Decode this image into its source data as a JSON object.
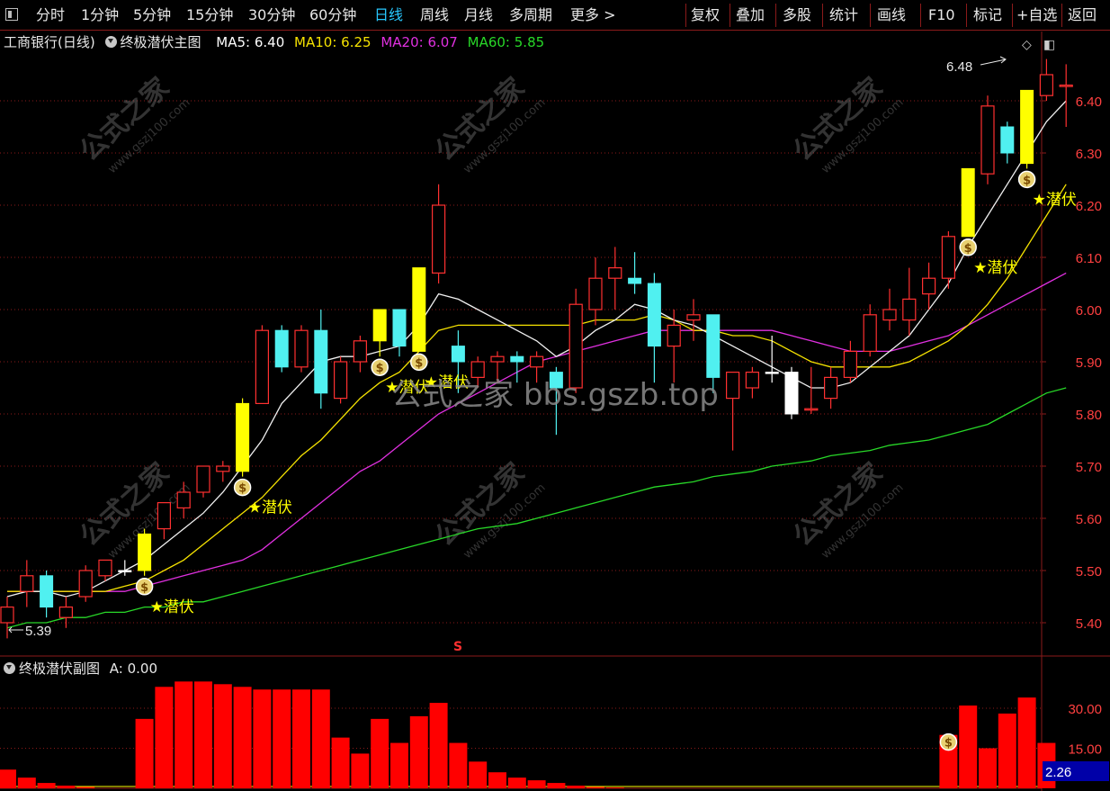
{
  "toolbar": {
    "left_items": [
      "分时",
      "1分钟",
      "5分钟",
      "15分钟",
      "30分钟",
      "60分钟",
      "日线",
      "周线",
      "月线",
      "多周期",
      "更多 >"
    ],
    "active_item": "日线",
    "right_items": [
      "复权",
      "叠加",
      "多股",
      "统计",
      "画线",
      "F10",
      "标记",
      "+自选",
      "返回"
    ]
  },
  "main_panel": {
    "title": "工商银行(日线)",
    "indicator_name": "终极潜伏主图",
    "ma": [
      {
        "label": "MA5: 6.40",
        "color": "#ffffff"
      },
      {
        "label": "MA10: 6.25",
        "color": "#f5e200"
      },
      {
        "label": "MA20: 6.07",
        "color": "#e030e0"
      },
      {
        "label": "MA60: 5.85",
        "color": "#28d828"
      }
    ],
    "high_label": "6.48",
    "low_label": "5.39",
    "signal_text": "潜伏",
    "signal_icon": "money-bag-icon",
    "event_mark": "S"
  },
  "sub_panel": {
    "indicator_name": "终极潜伏副图",
    "a_label": "A: 0.00",
    "current_value": "2.26",
    "y_ticks": [
      "30.00",
      "15.00"
    ]
  },
  "watermarks": {
    "text_cn": "公式之家",
    "text_url": "www.gszj100.com",
    "center_text": "公式之家 bbs.gszb.top"
  },
  "colors": {
    "up": "#ff3030",
    "down": "#50f0f0",
    "yellow_bar": "#ffff00",
    "grid": "#8b1a1a",
    "axis_text": "#ff4040",
    "bar": "#ff0000"
  },
  "chart_data": [
    {
      "type": "candlestick",
      "ylim": [
        5.35,
        6.5
      ],
      "y_ticks": [
        6.4,
        6.3,
        6.2,
        6.1,
        6.0,
        5.9,
        5.8,
        5.7,
        5.6,
        5.5,
        5.4
      ],
      "candles": [
        {
          "o": 5.4,
          "h": 5.45,
          "l": 5.37,
          "c": 5.43
        },
        {
          "o": 5.46,
          "h": 5.52,
          "l": 5.43,
          "c": 5.49
        },
        {
          "o": 5.49,
          "h": 5.5,
          "l": 5.41,
          "c": 5.43
        },
        {
          "o": 5.41,
          "h": 5.45,
          "l": 5.39,
          "c": 5.43
        },
        {
          "o": 5.45,
          "h": 5.51,
          "l": 5.44,
          "c": 5.5
        },
        {
          "o": 5.49,
          "h": 5.52,
          "l": 5.48,
          "c": 5.52
        },
        {
          "o": 5.5,
          "h": 5.52,
          "l": 5.49,
          "c": 5.5
        },
        {
          "o": 5.5,
          "h": 5.58,
          "l": 5.49,
          "c": 5.57
        },
        {
          "o": 5.58,
          "h": 5.63,
          "l": 5.56,
          "c": 5.63
        },
        {
          "o": 5.62,
          "h": 5.67,
          "l": 5.6,
          "c": 5.65
        },
        {
          "o": 5.65,
          "h": 5.7,
          "l": 5.64,
          "c": 5.7
        },
        {
          "o": 5.69,
          "h": 5.71,
          "l": 5.67,
          "c": 5.7
        },
        {
          "o": 5.69,
          "h": 5.83,
          "l": 5.68,
          "c": 5.82
        },
        {
          "o": 5.82,
          "h": 5.97,
          "l": 5.82,
          "c": 5.96
        },
        {
          "o": 5.96,
          "h": 5.97,
          "l": 5.88,
          "c": 5.89
        },
        {
          "o": 5.89,
          "h": 5.97,
          "l": 5.88,
          "c": 5.96
        },
        {
          "o": 5.96,
          "h": 6.0,
          "l": 5.81,
          "c": 5.84
        },
        {
          "o": 5.83,
          "h": 5.91,
          "l": 5.82,
          "c": 5.9
        },
        {
          "o": 5.9,
          "h": 5.95,
          "l": 5.88,
          "c": 5.94
        },
        {
          "o": 5.94,
          "h": 6.0,
          "l": 5.91,
          "c": 6.0
        },
        {
          "o": 6.0,
          "h": 6.0,
          "l": 5.91,
          "c": 5.93
        },
        {
          "o": 5.92,
          "h": 6.08,
          "l": 5.92,
          "c": 6.08
        },
        {
          "o": 6.07,
          "h": 6.24,
          "l": 6.05,
          "c": 6.2
        },
        {
          "o": 5.93,
          "h": 5.96,
          "l": 5.84,
          "c": 5.9
        },
        {
          "o": 5.87,
          "h": 5.91,
          "l": 5.85,
          "c": 5.9
        },
        {
          "o": 5.9,
          "h": 5.92,
          "l": 5.86,
          "c": 5.91
        },
        {
          "o": 5.91,
          "h": 5.92,
          "l": 5.86,
          "c": 5.9
        },
        {
          "o": 5.89,
          "h": 5.92,
          "l": 5.86,
          "c": 5.91
        },
        {
          "o": 5.88,
          "h": 5.89,
          "l": 5.76,
          "c": 5.85
        },
        {
          "o": 5.85,
          "h": 6.04,
          "l": 5.84,
          "c": 6.01
        },
        {
          "o": 6.0,
          "h": 6.1,
          "l": 5.97,
          "c": 6.06
        },
        {
          "o": 6.06,
          "h": 6.12,
          "l": 6.0,
          "c": 6.08
        },
        {
          "o": 6.06,
          "h": 6.11,
          "l": 6.03,
          "c": 6.05
        },
        {
          "o": 6.05,
          "h": 6.07,
          "l": 5.86,
          "c": 5.93
        },
        {
          "o": 5.93,
          "h": 6.0,
          "l": 5.86,
          "c": 5.97
        },
        {
          "o": 5.98,
          "h": 6.02,
          "l": 5.94,
          "c": 5.99
        },
        {
          "o": 5.99,
          "h": 5.99,
          "l": 5.84,
          "c": 5.87
        },
        {
          "o": 5.83,
          "h": 5.88,
          "l": 5.73,
          "c": 5.88
        },
        {
          "o": 5.85,
          "h": 5.89,
          "l": 5.83,
          "c": 5.88
        },
        {
          "o": 5.88,
          "h": 5.95,
          "l": 5.86,
          "c": 5.88
        },
        {
          "o": 5.88,
          "h": 5.89,
          "l": 5.79,
          "c": 5.8
        },
        {
          "o": 5.81,
          "h": 5.89,
          "l": 5.8,
          "c": 5.81
        },
        {
          "o": 5.83,
          "h": 5.89,
          "l": 5.81,
          "c": 5.87
        },
        {
          "o": 5.87,
          "h": 5.94,
          "l": 5.86,
          "c": 5.92
        },
        {
          "o": 5.92,
          "h": 6.01,
          "l": 5.91,
          "c": 5.99
        },
        {
          "o": 5.98,
          "h": 6.04,
          "l": 5.96,
          "c": 6.0
        },
        {
          "o": 5.98,
          "h": 6.08,
          "l": 5.95,
          "c": 6.02
        },
        {
          "o": 6.03,
          "h": 6.09,
          "l": 6.0,
          "c": 6.06
        },
        {
          "o": 6.06,
          "h": 6.15,
          "l": 6.04,
          "c": 6.14
        },
        {
          "o": 6.14,
          "h": 6.27,
          "l": 6.14,
          "c": 6.27
        },
        {
          "o": 6.26,
          "h": 6.41,
          "l": 6.24,
          "c": 6.39
        },
        {
          "o": 6.35,
          "h": 6.36,
          "l": 6.28,
          "c": 6.3
        },
        {
          "o": 6.28,
          "h": 6.42,
          "l": 6.27,
          "c": 6.42
        },
        {
          "o": 6.41,
          "h": 6.48,
          "l": 6.4,
          "c": 6.45
        },
        {
          "o": 6.43,
          "h": 6.47,
          "l": 6.35,
          "c": 6.43
        }
      ],
      "yellow_bars": [
        7,
        12,
        19,
        21,
        49,
        52
      ],
      "doji_white": [
        6,
        39,
        40
      ],
      "signals": [
        {
          "i": 7,
          "text": "潜伏",
          "bag": true
        },
        {
          "i": 12,
          "text": "潜伏",
          "bag": true
        },
        {
          "i": 19,
          "text": "潜伏",
          "bag": true
        },
        {
          "i": 21,
          "text": "潜伏",
          "bag": true
        },
        {
          "i": 49,
          "text": "潜伏",
          "bag": true
        },
        {
          "i": 52,
          "text": "潜伏",
          "bag": true
        }
      ],
      "ma5": [
        5.45,
        5.46,
        5.46,
        5.45,
        5.46,
        5.48,
        5.5,
        5.52,
        5.55,
        5.58,
        5.61,
        5.65,
        5.7,
        5.75,
        5.82,
        5.86,
        5.9,
        5.91,
        5.91,
        5.92,
        5.93,
        5.97,
        6.03,
        6.02,
        6.0,
        5.98,
        5.96,
        5.94,
        5.91,
        5.93,
        5.96,
        5.98,
        6.01,
        6.0,
        5.98,
        5.97,
        5.95,
        5.93,
        5.91,
        5.89,
        5.87,
        5.85,
        5.85,
        5.86,
        5.89,
        5.92,
        5.95,
        6.0,
        6.05,
        6.12,
        6.18,
        6.24,
        6.3,
        6.36,
        6.4
      ],
      "ma10": [
        5.46,
        5.46,
        5.46,
        5.46,
        5.46,
        5.46,
        5.47,
        5.48,
        5.5,
        5.52,
        5.55,
        5.58,
        5.61,
        5.64,
        5.68,
        5.72,
        5.75,
        5.79,
        5.83,
        5.86,
        5.88,
        5.92,
        5.96,
        5.97,
        5.97,
        5.97,
        5.97,
        5.97,
        5.97,
        5.97,
        5.98,
        5.98,
        5.98,
        5.99,
        5.98,
        5.96,
        5.96,
        5.95,
        5.95,
        5.94,
        5.92,
        5.9,
        5.89,
        5.89,
        5.89,
        5.89,
        5.9,
        5.92,
        5.94,
        5.97,
        6.01,
        6.06,
        6.12,
        6.18,
        6.24
      ],
      "ma20": [
        5.46,
        5.46,
        5.46,
        5.46,
        5.46,
        5.46,
        5.46,
        5.47,
        5.48,
        5.49,
        5.5,
        5.51,
        5.52,
        5.54,
        5.57,
        5.6,
        5.63,
        5.66,
        5.69,
        5.71,
        5.74,
        5.77,
        5.8,
        5.82,
        5.84,
        5.86,
        5.88,
        5.9,
        5.91,
        5.92,
        5.93,
        5.94,
        5.95,
        5.96,
        5.96,
        5.96,
        5.96,
        5.96,
        5.96,
        5.96,
        5.95,
        5.94,
        5.93,
        5.92,
        5.92,
        5.92,
        5.93,
        5.94,
        5.95,
        5.97,
        5.99,
        6.01,
        6.03,
        6.05,
        6.07
      ],
      "ma60": [
        5.39,
        5.4,
        5.4,
        5.41,
        5.41,
        5.42,
        5.42,
        5.43,
        5.43,
        5.44,
        5.44,
        5.45,
        5.46,
        5.47,
        5.48,
        5.49,
        5.5,
        5.51,
        5.52,
        5.53,
        5.54,
        5.55,
        5.56,
        5.57,
        5.58,
        5.585,
        5.59,
        5.6,
        5.61,
        5.62,
        5.63,
        5.64,
        5.65,
        5.66,
        5.665,
        5.67,
        5.68,
        5.685,
        5.69,
        5.7,
        5.705,
        5.71,
        5.72,
        5.725,
        5.73,
        5.74,
        5.745,
        5.75,
        5.76,
        5.77,
        5.78,
        5.8,
        5.82,
        5.84,
        5.85
      ]
    },
    {
      "type": "bar",
      "ylim": [
        0,
        40
      ],
      "values": [
        7,
        4,
        2,
        1,
        0.5,
        0,
        0,
        26,
        38,
        40,
        40,
        39,
        38,
        37,
        37,
        37,
        37,
        19,
        13,
        26,
        17,
        27,
        32,
        17,
        10,
        6,
        4,
        3,
        2,
        1,
        0.5,
        0.3,
        0,
        0,
        0,
        0,
        0,
        0,
        0,
        0,
        0,
        0,
        0,
        0,
        0,
        0,
        0,
        0,
        20,
        31,
        15,
        28,
        34,
        17
      ]
    }
  ]
}
